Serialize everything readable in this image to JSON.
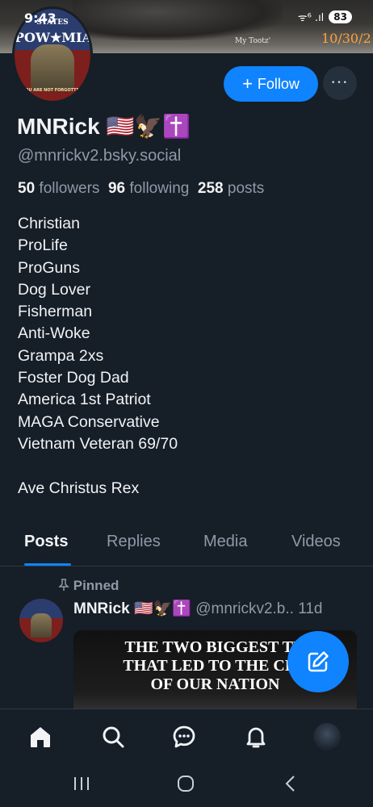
{
  "status_bar": {
    "time": "9:43",
    "battery": "83",
    "signal": "ᯤ⁶ .ıl"
  },
  "banner": {
    "tag_text": "My Tootz'",
    "date_text": "10/30/2"
  },
  "avatar": {
    "line1": "STATES",
    "line2": "POW★MIA",
    "line3": "YOU ARE NOT FORGOTTEN"
  },
  "actions": {
    "follow_label": "Follow",
    "follow_icon": "+",
    "more_icon": "•••"
  },
  "profile": {
    "name": "MNRick 🇺🇸🦅✝️",
    "handle": "@mnrickv2.bsky.social",
    "followers_count": "50",
    "followers_label": "followers",
    "following_count": "96",
    "following_label": "following",
    "posts_count": "258",
    "posts_label": "posts",
    "bio": [
      "Christian",
      "ProLife",
      "ProGuns",
      "Dog Lover",
      "Fisherman",
      "Anti-Woke",
      "Grampa 2xs",
      "Foster Dog Dad",
      "America 1st Patriot",
      "MAGA Conservative",
      "Vietnam Veteran 69/70",
      "",
      "Ave Christus Rex"
    ]
  },
  "tabs": [
    {
      "label": "Posts",
      "active": true
    },
    {
      "label": "Replies",
      "active": false
    },
    {
      "label": "Media",
      "active": false
    },
    {
      "label": "Videos",
      "active": false
    }
  ],
  "post": {
    "pinned_label": "Pinned",
    "author_name": "MNRick 🇺🇸🦅✝️",
    "author_handle": "@mnrickv2.b..",
    "age": "11d",
    "image_caption_lines": [
      "THE TWO BIGGEST TH",
      "THAT LED TO THE CRE",
      "OF OUR NATION"
    ]
  },
  "colors": {
    "accent": "#1083fe",
    "background": "#161e27",
    "muted_text": "#8e9aa8"
  },
  "icons": {
    "nav": [
      "home-icon",
      "search-icon",
      "chat-icon",
      "bell-icon",
      "profile-avatar"
    ],
    "fab": "compose-icon",
    "system": [
      "recent-apps-icon",
      "home-circle-icon",
      "back-icon"
    ]
  }
}
